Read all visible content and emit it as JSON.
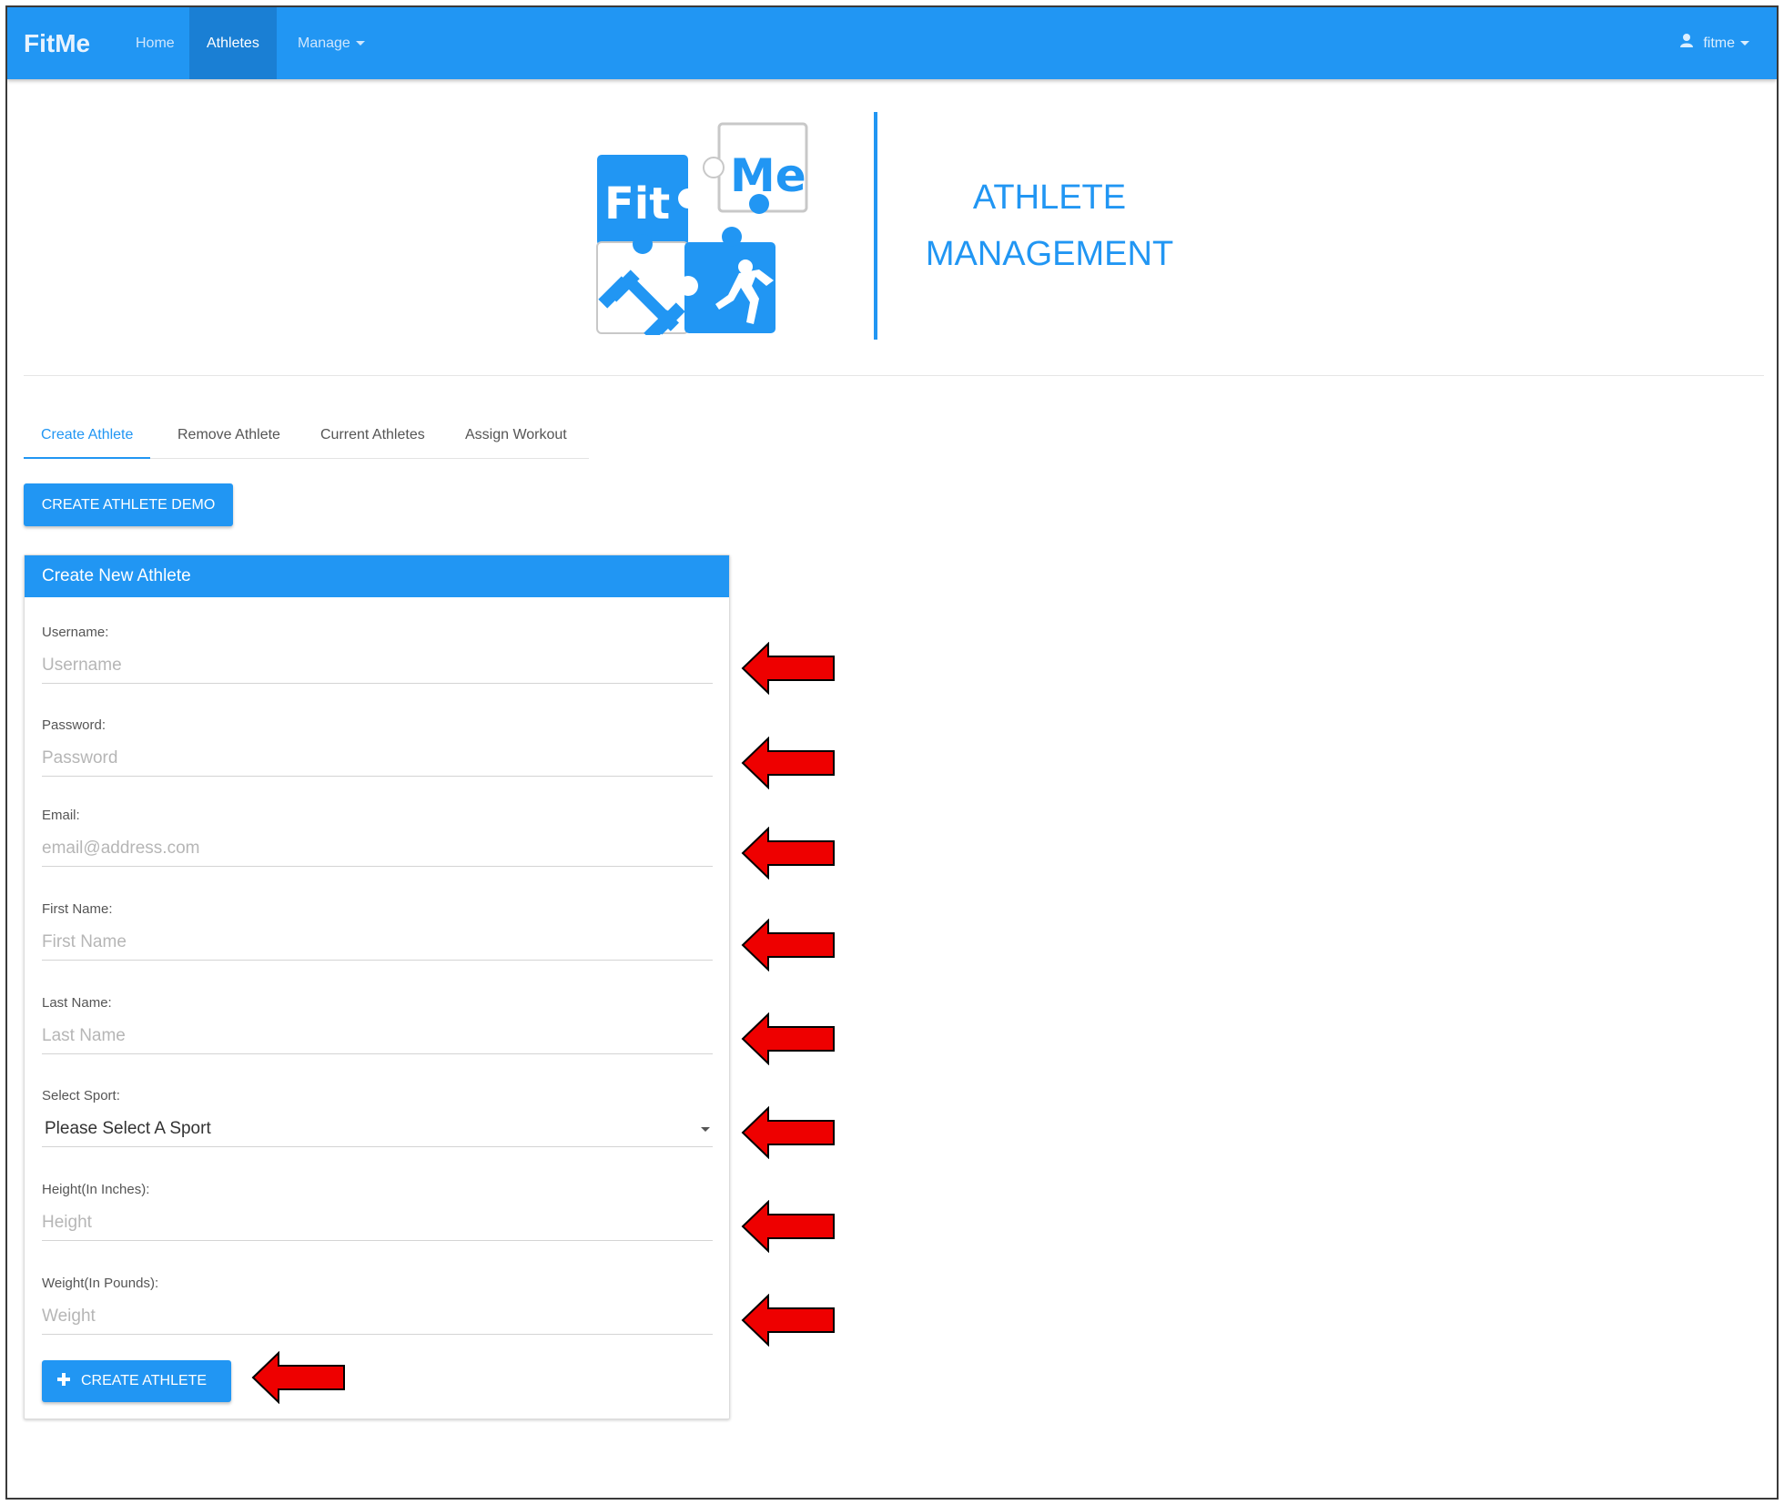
{
  "navbar": {
    "brand": "FitMe",
    "items": [
      {
        "label": "Home"
      },
      {
        "label": "Athletes"
      },
      {
        "label": "Manage"
      }
    ],
    "user": "fitme"
  },
  "logo": {
    "fit": "Fit",
    "me": "Me"
  },
  "header": {
    "line1": "ATHLETE",
    "line2": "MANAGEMENT"
  },
  "tabs": [
    {
      "label": "Create Athlete"
    },
    {
      "label": "Remove Athlete"
    },
    {
      "label": "Current Athletes"
    },
    {
      "label": "Assign Workout"
    }
  ],
  "demo_button": "CREATE ATHLETE DEMO",
  "panel": {
    "title": "Create New Athlete",
    "fields": [
      {
        "label": "Username:",
        "placeholder": "Username"
      },
      {
        "label": "Password:",
        "placeholder": "Password"
      },
      {
        "label": "Email:",
        "placeholder": "email@address.com"
      },
      {
        "label": "First Name:",
        "placeholder": "First Name"
      },
      {
        "label": "Last Name:",
        "placeholder": "Last Name"
      },
      {
        "label": "Select Sport:",
        "value": "Please Select A Sport"
      },
      {
        "label": "Height(In Inches):",
        "placeholder": "Height"
      },
      {
        "label": "Weight(In Pounds):",
        "placeholder": "Weight"
      }
    ],
    "submit": "CREATE ATHLETE"
  },
  "colors": {
    "primary": "#2196f3",
    "nav_active": "#1a7fd4",
    "annotation_arrow": "#ee0000"
  }
}
